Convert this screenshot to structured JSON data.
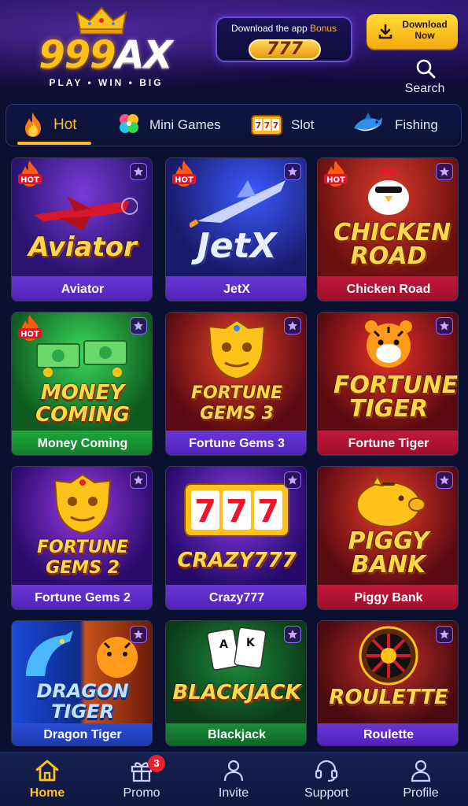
{
  "header": {
    "logo_numbers": "999",
    "logo_letters": "AX",
    "logo_tagline": "PLAY • WIN • BIG",
    "bonus_prefix": "Download the app",
    "bonus_highlight": "Bonus",
    "bonus_amount": "777",
    "download_label": "Download Now",
    "search_label": "Search"
  },
  "categories": [
    {
      "label": "Hot",
      "icon": "fire-icon",
      "active": true
    },
    {
      "label": "Mini Games",
      "icon": "clover-icon",
      "active": false
    },
    {
      "label": "Slot",
      "icon": "slot-machine-icon",
      "active": false
    },
    {
      "label": "Fishing",
      "icon": "shark-icon",
      "active": false
    }
  ],
  "games": [
    {
      "name": "Aviator",
      "art_title": "Aviator",
      "hot": true
    },
    {
      "name": "JetX",
      "art_title": "JetX",
      "hot": true
    },
    {
      "name": "Chicken Road",
      "art_title": "CHICKEN ROAD",
      "hot": true
    },
    {
      "name": "Money Coming",
      "art_title": "MONEY COMING",
      "hot": true
    },
    {
      "name": "Fortune Gems 3",
      "art_title": "FORTUNE GEMS 3",
      "hot": false
    },
    {
      "name": "Fortune Tiger",
      "art_title": "FORTUNE TIGER",
      "hot": false
    },
    {
      "name": "Fortune Gems 2",
      "art_title": "FORTUNE GEMS 2",
      "hot": false
    },
    {
      "name": "Crazy777",
      "art_title": "CRAZY777",
      "hot": false
    },
    {
      "name": "Piggy Bank",
      "art_title": "PIGGY BANK",
      "hot": false
    },
    {
      "name": "Dragon Tiger",
      "art_title": "DRAGON TIGER",
      "hot": false
    },
    {
      "name": "Blackjack",
      "art_title": "BLACKJACK",
      "hot": false
    },
    {
      "name": "Roulette",
      "art_title": "ROULETTE",
      "hot": false
    }
  ],
  "hot_badge_text": "HOT",
  "nav": [
    {
      "label": "Home",
      "icon": "home-icon",
      "active": true
    },
    {
      "label": "Promo",
      "icon": "gift-icon",
      "active": false,
      "badge": "3"
    },
    {
      "label": "Invite",
      "icon": "people-icon",
      "active": false
    },
    {
      "label": "Support",
      "icon": "headset-icon",
      "active": false
    },
    {
      "label": "Profile",
      "icon": "user-icon",
      "active": false
    }
  ],
  "colors": {
    "accent_gold": "#ffc21a",
    "background": "#0b1030",
    "promo_badge": "#e8222e"
  }
}
